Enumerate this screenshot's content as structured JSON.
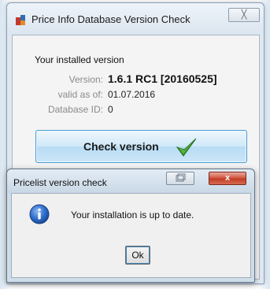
{
  "main_window": {
    "title": "Price Info Database Version Check",
    "close_glyph": "╳",
    "installed_label": "Your installed version",
    "version": {
      "label": "Version:",
      "value": "1.6.1 RC1 [20160525]"
    },
    "valid_as_of": {
      "label": "valid as of:",
      "value": "01.07.2016"
    },
    "database_id": {
      "label": "Database ID:",
      "value": "0"
    },
    "check_button": {
      "label": "Check version",
      "icon": "checkmark-icon"
    }
  },
  "dialog": {
    "title": "Pricelist version check",
    "close_glyph": "x",
    "message": "Your installation is up to date.",
    "icon": "info-icon",
    "ok_label": "Ok"
  },
  "colors": {
    "button_border": "#4e9bd3",
    "checkmark": "#3e9a2f",
    "info_icon": "#1e5bb6",
    "close_button": "#c9452d"
  }
}
